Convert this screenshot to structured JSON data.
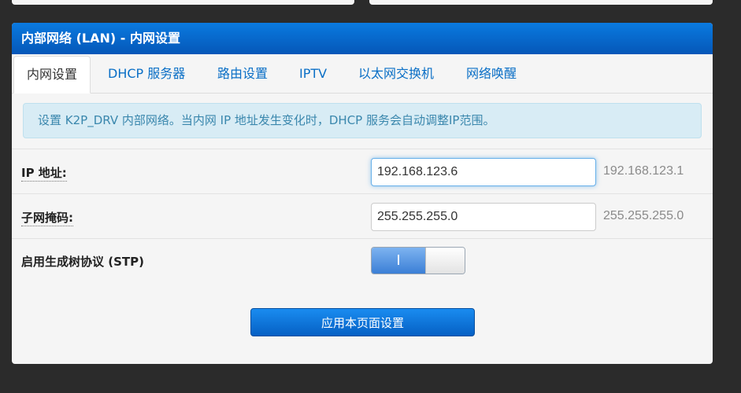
{
  "panel": {
    "title": "内部网络 (LAN) - 内网设置"
  },
  "tabs": [
    {
      "label": "内网设置",
      "active": true
    },
    {
      "label": "DHCP 服务器",
      "active": false
    },
    {
      "label": "路由设置",
      "active": false
    },
    {
      "label": "IPTV",
      "active": false
    },
    {
      "label": "以太网交换机",
      "active": false
    },
    {
      "label": "网络唤醒",
      "active": false
    }
  ],
  "info": {
    "text": "设置 K2P_DRV 内部网络。当内网 IP 地址发生变化时，DHCP 服务会自动调整IP范围。"
  },
  "fields": {
    "ip_address": {
      "label": "IP 地址:",
      "value": "192.168.123.6",
      "default": "192.168.123.1"
    },
    "subnet_mask": {
      "label": "子网掩码:",
      "value": "255.255.255.0",
      "default": "255.255.255.0"
    },
    "stp": {
      "label": "启用生成树协议 (STP)",
      "state_label": "I",
      "enabled": true
    }
  },
  "apply_button": {
    "label": "应用本页面设置"
  },
  "colors": {
    "accent": "#0a6fc6",
    "header": "#0557b8",
    "info_bg": "#d8ecf5",
    "info_text": "#3a87ad"
  }
}
